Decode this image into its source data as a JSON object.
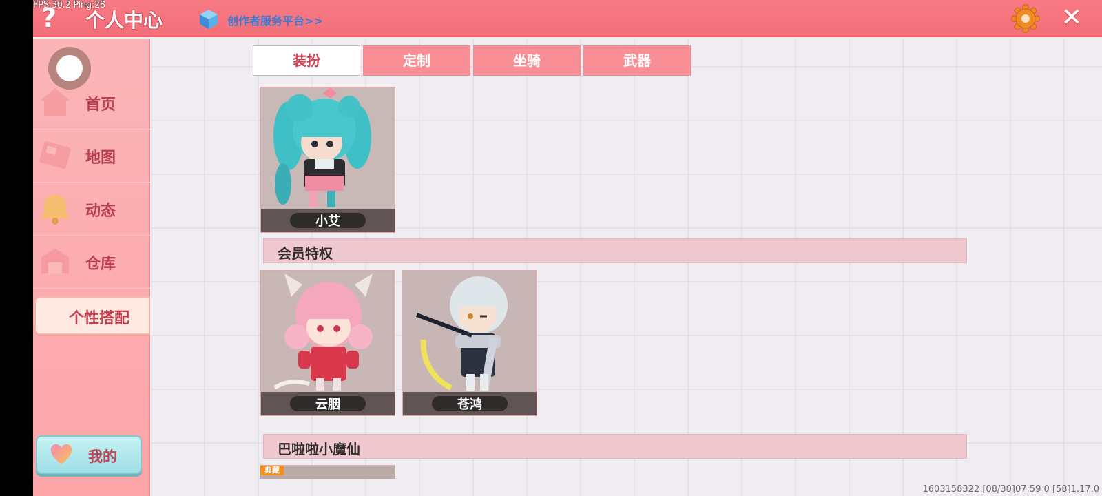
{
  "debug": {
    "fps": "FPS:30.2",
    "ping": "Ping:28"
  },
  "header": {
    "title": "个人中心",
    "creator_link": "创作者服务平台>>",
    "help_symbol": "?",
    "close_symbol": "✕",
    "accent": "#f5737d"
  },
  "sidebar": {
    "items": [
      {
        "label": "首页",
        "icon": "home-icon"
      },
      {
        "label": "地图",
        "icon": "map-icon"
      },
      {
        "label": "动态",
        "icon": "bell-icon"
      },
      {
        "label": "仓库",
        "icon": "warehouse-icon"
      },
      {
        "label": "个性搭配",
        "icon": "",
        "active": true
      }
    ],
    "mine_label": "我的"
  },
  "tabs": [
    {
      "label": "装扮",
      "active": true
    },
    {
      "label": "定制"
    },
    {
      "label": "坐骑"
    },
    {
      "label": "武器"
    }
  ],
  "featured_skin": {
    "name": "小艾"
  },
  "sections": [
    {
      "title": "会员特权",
      "skins": [
        {
          "name": "云胭"
        },
        {
          "name": "苍鸿"
        }
      ]
    },
    {
      "title": "巴啦啦小魔仙",
      "partial_tag": "典藏"
    }
  ],
  "build_info": "1603158322  [08/30]07:59 0  [58]1.17.0"
}
